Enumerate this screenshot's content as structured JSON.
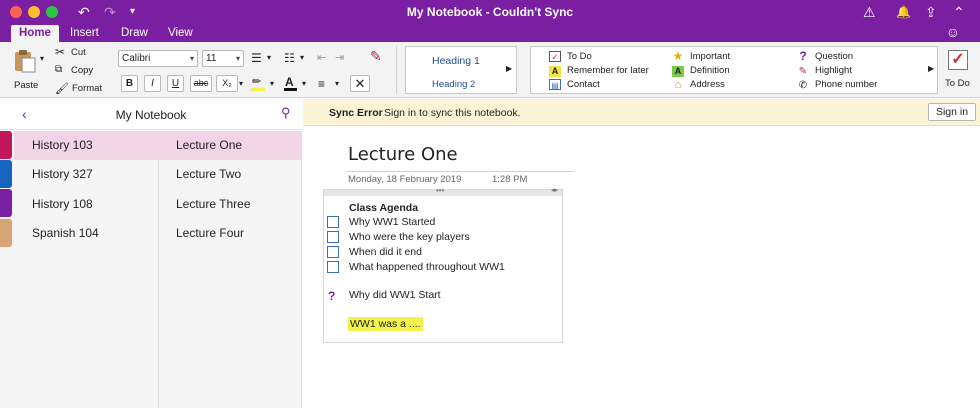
{
  "window": {
    "title": "My Notebook - Couldn't Sync"
  },
  "tabs": [
    "Home",
    "Insert",
    "Draw",
    "View"
  ],
  "ribbon": {
    "paste": "Paste",
    "cut": "Cut",
    "copy": "Copy",
    "format": "Format",
    "font_name": "Calibri",
    "font_size": "11",
    "bold": "B",
    "italic": "I",
    "underline": "U",
    "strike": "abc",
    "subscript": "X₂",
    "styles": [
      "Heading 1",
      "Heading 2"
    ],
    "tags_col1": [
      "To Do",
      "Remember for later",
      "Contact"
    ],
    "tags_col2": [
      "Important",
      "Definition",
      "Address"
    ],
    "tags_col3": [
      "Question",
      "Highlight",
      "Phone number"
    ],
    "todo_big": "To Do"
  },
  "notebook": {
    "title": "My Notebook",
    "sections": [
      {
        "label": "History 103",
        "color": "#c2185b"
      },
      {
        "label": "History 327",
        "color": "#1565c0"
      },
      {
        "label": "History 108",
        "color": "#7b1fa2"
      },
      {
        "label": "Spanish 104",
        "color": "#d7a574"
      }
    ],
    "pages": [
      "Lecture One",
      "Lecture Two",
      "Lecture Three",
      "Lecture Four"
    ]
  },
  "sync": {
    "error": "Sync Error",
    "message": "Sign in to sync this notebook.",
    "signin": "Sign in"
  },
  "page": {
    "title": "Lecture One",
    "date": "Monday, 18 February 2019",
    "time": "1:28 PM",
    "agenda_title": "Class Agenda",
    "todos": [
      "Why WW1 Started",
      "Who were the key players",
      "When did it end",
      "What happened throughout WW1"
    ],
    "question": "Why did WW1 Start",
    "highlight": "WW1 was a ...."
  }
}
